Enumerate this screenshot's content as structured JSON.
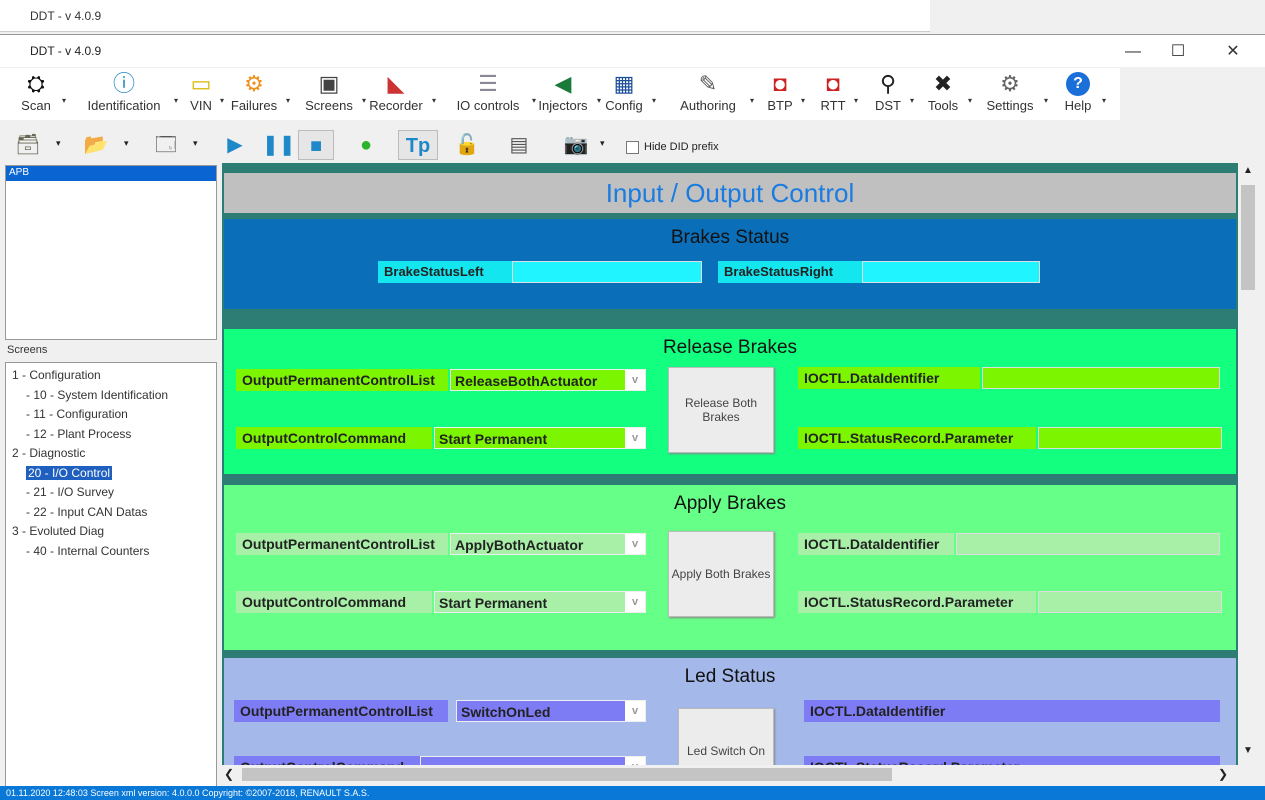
{
  "background_window": {
    "title": "DDT - v 4.0.9"
  },
  "window": {
    "title": "DDT - v 4.0.9",
    "minimize": "—",
    "maximize": "☐",
    "close": "✕"
  },
  "toolbar": [
    {
      "label": "Scan",
      "icon": "binoculars-icon",
      "glyph": "⛭"
    },
    {
      "label": "Identification",
      "icon": "info-icon",
      "glyph": "ⓘ"
    },
    {
      "label": "VIN",
      "icon": "vin-icon",
      "glyph": "▭"
    },
    {
      "label": "Failures",
      "icon": "engine-icon",
      "glyph": "⚙"
    },
    {
      "label": "Screens",
      "icon": "monitor-icon",
      "glyph": "▣"
    },
    {
      "label": "Recorder",
      "icon": "recorder-icon",
      "glyph": "◣"
    },
    {
      "label": "IO controls",
      "icon": "sliders-icon",
      "glyph": "☰"
    },
    {
      "label": "Injectors",
      "icon": "injector-icon",
      "glyph": "◀"
    },
    {
      "label": "Config",
      "icon": "chip-icon",
      "glyph": "▦"
    },
    {
      "label": "Authoring",
      "icon": "pen-icon",
      "glyph": "✎"
    },
    {
      "label": "BTP",
      "icon": "btp-icon",
      "glyph": "◘"
    },
    {
      "label": "RTT",
      "icon": "rtt-icon",
      "glyph": "◘"
    },
    {
      "label": "DST",
      "icon": "magnifier-icon",
      "glyph": "⚲"
    },
    {
      "label": "Tools",
      "icon": "tools-icon",
      "glyph": "✖"
    },
    {
      "label": "Settings",
      "icon": "gear-icon",
      "glyph": "⚙"
    },
    {
      "label": "Help",
      "icon": "help-icon",
      "glyph": "?"
    }
  ],
  "toolbar2": {
    "hide_did_prefix": "Hide DID prefix",
    "tp": "Tp"
  },
  "ecu_list": [
    "APB"
  ],
  "screens_label": "Screens",
  "tree": [
    {
      "label": "1 - Configuration",
      "level": 1
    },
    {
      "label": "10 - System Identification",
      "level": 2
    },
    {
      "label": "11 - Configuration",
      "level": 2
    },
    {
      "label": "12 - Plant Process",
      "level": 2
    },
    {
      "label": "2 - Diagnostic",
      "level": 1
    },
    {
      "label": "20 - I/O Control",
      "level": 2,
      "selected": true
    },
    {
      "label": "21 - I/O Survey",
      "level": 2
    },
    {
      "label": "22 - Input CAN Datas",
      "level": 2
    },
    {
      "label": "3 - Evoluted Diag",
      "level": 1
    },
    {
      "label": "40 - Internal Counters",
      "level": 2
    }
  ],
  "main": {
    "title": "Input / Output Control",
    "brakes_status": {
      "title": "Brakes Status",
      "left": "BrakeStatusLeft",
      "right": "BrakeStatusRight"
    },
    "release": {
      "title": "Release Brakes",
      "opcl_label": "OutputPermanentControlList",
      "opcl_value": "ReleaseBothActuator",
      "occ_label": "OutputControlCommand",
      "occ_value": "Start Permanent",
      "button": "Release Both Brakes",
      "did_label": "IOCTL.DataIdentifier",
      "sr_label": "IOCTL.StatusRecord.Parameter"
    },
    "apply": {
      "title": "Apply Brakes",
      "opcl_label": "OutputPermanentControlList",
      "opcl_value": "ApplyBothActuator",
      "occ_label": "OutputControlCommand",
      "occ_value": "Start Permanent",
      "button": "Apply Both Brakes",
      "did_label": "IOCTL.DataIdentifier",
      "sr_label": "IOCTL.StatusRecord.Parameter"
    },
    "led": {
      "title": "Led Status",
      "opcl_label": "OutputPermanentControlList",
      "opcl_value": "SwitchOnLed",
      "occ_label": "OutputControlCommand",
      "button": "Led Switch On",
      "did_label": "IOCTL.DataIdentifier",
      "sr_label": "IOCTL.StatusRecord.Parameter"
    }
  },
  "status_bar": "01.11.2020 12:48:03   Screen xml version: 4.0.0.0   Copyright: ©2007-2018, RENAULT S.A.S.",
  "colors": {
    "release_bg": "#12ff80",
    "apply_bg": "#66ff88",
    "led_bg": "#a4b8ea",
    "brakes_bg": "#0a6fb8"
  }
}
